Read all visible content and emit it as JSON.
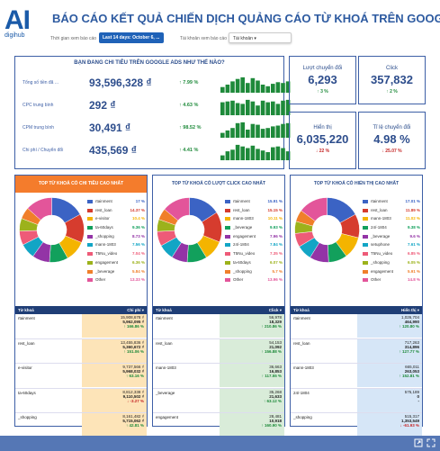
{
  "brand": {
    "logo_text": "AI",
    "logo_sub": "digihub"
  },
  "title": "BÁO CÁO KẾT QUẢ CHIẾN DỊCH QUẢNG CÁO TỪ KHOÁ TRÊN GOOGLE",
  "filters": {
    "time_label": "Thời gian xem báo cáo",
    "time_value": "Last 14 days: October 6, ... ▾",
    "account_label": "Tài khoản xem báo cáo",
    "account_value": "Tài khoản ▾"
  },
  "spend_panel": {
    "title": "BẠN ĐANG CHI TIÊU TRÊN GOOGLE ADS NHƯ THẾ NÀO?",
    "rows": [
      {
        "label": "Tổng số tiền đã ...",
        "value": "93,596,328 ₫",
        "pct": "↑ 7.99 %",
        "bars": [
          0.35,
          0.5,
          0.7,
          0.85,
          0.95,
          0.6,
          0.9,
          0.75,
          0.5,
          0.4,
          0.55,
          0.65,
          0.6,
          0.7
        ]
      },
      {
        "label": "CPC trung bình",
        "value": "292 ₫",
        "pct": "↑ 4.63 %",
        "bars": [
          0.8,
          0.85,
          0.9,
          0.75,
          0.7,
          0.95,
          0.85,
          0.6,
          0.9,
          0.8,
          0.85,
          0.7,
          0.9,
          0.95
        ]
      },
      {
        "label": "CPM trung bình",
        "value": "30,491 ₫",
        "pct": "↑ 98.52 %",
        "bars": [
          0.3,
          0.45,
          0.6,
          0.9,
          0.95,
          0.5,
          0.85,
          0.8,
          0.55,
          0.6,
          0.7,
          0.75,
          0.85,
          0.9
        ]
      },
      {
        "label": "Chi phí / Chuyển đổi",
        "value": "435,569 ₫",
        "pct": "↑ 4.41 %",
        "bars": [
          0.3,
          0.55,
          0.65,
          0.95,
          0.85,
          0.75,
          0.9,
          0.7,
          0.6,
          0.5,
          0.8,
          0.85,
          0.75,
          0.55
        ]
      }
    ]
  },
  "kpis": [
    {
      "label": "Lượt chuyển đổi",
      "value": "6,293",
      "pct": "↑ 3 %",
      "trend": "up"
    },
    {
      "label": "Click",
      "value": "357,832",
      "pct": "↑ 2 %",
      "trend": "up"
    },
    {
      "label": "Hiển thị",
      "value": "6,035,220",
      "pct": "↓ 22 %",
      "trend": "down"
    },
    {
      "label": "Tỉ lệ chuyển đổi",
      "value": "4.98 %",
      "pct": "↓ 25.07 %",
      "trend": "down"
    }
  ],
  "donut_panels": [
    {
      "title": "TOP TỪ KHOÁ CÓ CHI TIÊU CAO NHẤT",
      "legend": [
        {
          "name": "rtainment",
          "pct": "17 %",
          "color": "#3b63c4"
        },
        {
          "name": "rest_loan",
          "pct": "14.37 %",
          "color": "#d63c2e"
        },
        {
          "name": "e-visitor",
          "pct": "10.4 %",
          "color": "#f4b400"
        },
        {
          "name": "ta-60days",
          "pct": "9.36 %",
          "color": "#12a05c"
        },
        {
          "name": "_shopping",
          "pct": "8.73 %",
          "color": "#9334a6"
        },
        {
          "name": "mann-1803",
          "pct": "7.56 %",
          "color": "#12a5c5"
        },
        {
          "name": "T5Nu_video",
          "pct": "7.04 %",
          "color": "#ee5b78"
        },
        {
          "name": "engagement",
          "pct": "6.36 %",
          "color": "#9cb21b"
        },
        {
          "name": "_beverage",
          "pct": "5.84 %",
          "color": "#f07f2a"
        },
        {
          "name": "Other",
          "pct": "13.33 %",
          "color": "#e3559a"
        }
      ],
      "values": [
        17,
        14.37,
        10.4,
        9.36,
        8.73,
        7.56,
        7.04,
        6.36,
        5.84,
        13.33
      ],
      "table_head": [
        "Từ khoá",
        "Chi phí ▾"
      ],
      "rows": [
        {
          "name": "rtainment",
          "v1": "15,908,678 ₫",
          "v2": "5,962,095 ₫",
          "v3": "↑ 166.86 %",
          "trend": "up"
        },
        {
          "name": "rest_loan",
          "v1": "13,455,836 ₫",
          "v2": "5,360,672 ₫",
          "v3": "↑ 151.06 %",
          "trend": "up"
        },
        {
          "name": "e-visitor",
          "v1": "9,737,566 ₫",
          "v2": "5,968,032 ₫",
          "v3": "↑ 63.16 %",
          "trend": "up"
        },
        {
          "name": "ta-60days",
          "v1": "8,812,338 ₫",
          "v2": "9,110,502 ₫",
          "v3": "↓ -3.27 %",
          "trend": "down"
        },
        {
          "name": "_shopping",
          "v1": "8,161,482 ₫",
          "v2": "5,715,062 ₫",
          "v3": "↑ 42.81 %",
          "trend": "up"
        }
      ]
    },
    {
      "title": "TOP TỪ KHOÁ CÓ LƯỢT CLICK CAO NHẤT",
      "legend": [
        {
          "name": "rtainment",
          "pct": "15.91 %",
          "color": "#3b63c4"
        },
        {
          "name": "rest_loan",
          "pct": "15.15 %",
          "color": "#d63c2e"
        },
        {
          "name": "mann-1803",
          "pct": "10.11 %",
          "color": "#f4b400"
        },
        {
          "name": "_beverage",
          "pct": "9.93 %",
          "color": "#12a05c"
        },
        {
          "name": "engagement",
          "pct": "7.96 %",
          "color": "#9334a6"
        },
        {
          "name": "24/-1804",
          "pct": "7.84 %",
          "color": "#12a5c5"
        },
        {
          "name": "T5Nu_video",
          "pct": "7.35 %",
          "color": "#ee5b78"
        },
        {
          "name": "ta-60days",
          "pct": "6.07 %",
          "color": "#9cb21b"
        },
        {
          "name": "_shopping",
          "pct": "5.7 %",
          "color": "#f07f2a"
        },
        {
          "name": "Other",
          "pct": "13.96 %",
          "color": "#e3559a"
        }
      ],
      "values": [
        15.91,
        15.15,
        10.11,
        9.93,
        7.96,
        7.84,
        7.35,
        6.07,
        5.7,
        13.96
      ],
      "table_head": [
        "Từ khoá",
        "Click ▾"
      ],
      "rows": [
        {
          "name": "rtainment",
          "v1": "56,978",
          "v2": "18,329",
          "v3": "↑ 210.86 %",
          "trend": "up"
        },
        {
          "name": "rest_loan",
          "v1": "54,153",
          "v2": "21,092",
          "v3": "↑ 156.88 %",
          "trend": "up"
        },
        {
          "name": "mann-1803",
          "v1": "36,663",
          "v2": "16,853",
          "v3": "↑ 117.55 %",
          "trend": "up"
        },
        {
          "name": "_beverage",
          "v1": "35,268",
          "v2": "21,633",
          "v3": "↑ 63.12 %",
          "trend": "up"
        },
        {
          "name": "engagement",
          "v1": "28,481",
          "v2": "10,918",
          "v3": "↑ 160.90 %",
          "trend": "up"
        }
      ]
    },
    {
      "title": "TOP TỪ KHOÁ CÓ HIỂN THỊ CAO NHẤT",
      "legend": [
        {
          "name": "rtainment",
          "pct": "17.01 %",
          "color": "#3b63c4"
        },
        {
          "name": "rest_loan",
          "pct": "11.89 %",
          "color": "#d63c2e"
        },
        {
          "name": "mann-1803",
          "pct": "11.02 %",
          "color": "#f4b400"
        },
        {
          "name": "24/-1804",
          "pct": "9.38 %",
          "color": "#12a05c"
        },
        {
          "name": "_beverage",
          "pct": "9.6 %",
          "color": "#9334a6"
        },
        {
          "name": "setuphone",
          "pct": "7.61 %",
          "color": "#12a5c5"
        },
        {
          "name": "T5Nu_video",
          "pct": "6.85 %",
          "color": "#ee5b78"
        },
        {
          "name": "_shopping",
          "pct": "6.05 %",
          "color": "#9cb21b"
        },
        {
          "name": "engagement",
          "pct": "5.91 %",
          "color": "#f07f2a"
        },
        {
          "name": "Other",
          "pct": "14.8 %",
          "color": "#e3559a"
        }
      ],
      "values": [
        17.01,
        11.89,
        11.02,
        9.38,
        9.6,
        7.61,
        6.85,
        6.05,
        5.91,
        14.8
      ],
      "table_head": [
        "Từ khoá",
        "Hiển thị ▾"
      ],
      "rows": [
        {
          "name": "rtainment",
          "v1": "1,026,704",
          "v2": "464,990",
          "v3": "↑ 120.80 %",
          "trend": "up"
        },
        {
          "name": "rest_loan",
          "v1": "717,263",
          "v2": "314,896",
          "v3": "↑ 127.77 %",
          "trend": "up"
        },
        {
          "name": "mann-1803",
          "v1": "665,011",
          "v2": "263,053",
          "v3": "↑ 152.81 %",
          "trend": "up"
        },
        {
          "name": "24/-1804",
          "v1": "575,189",
          "v2": "0",
          "v3": "-",
          "trend": "none"
        },
        {
          "name": "_shopping",
          "v1": "515,317",
          "v2": "1,353,549",
          "v3": "↓ -61.93 %",
          "trend": "down"
        }
      ]
    }
  ],
  "colors": {
    "accent": "#3d5fa6",
    "orange": "#f47c2c",
    "up": "#1e8a3a",
    "down": "#c62828"
  }
}
